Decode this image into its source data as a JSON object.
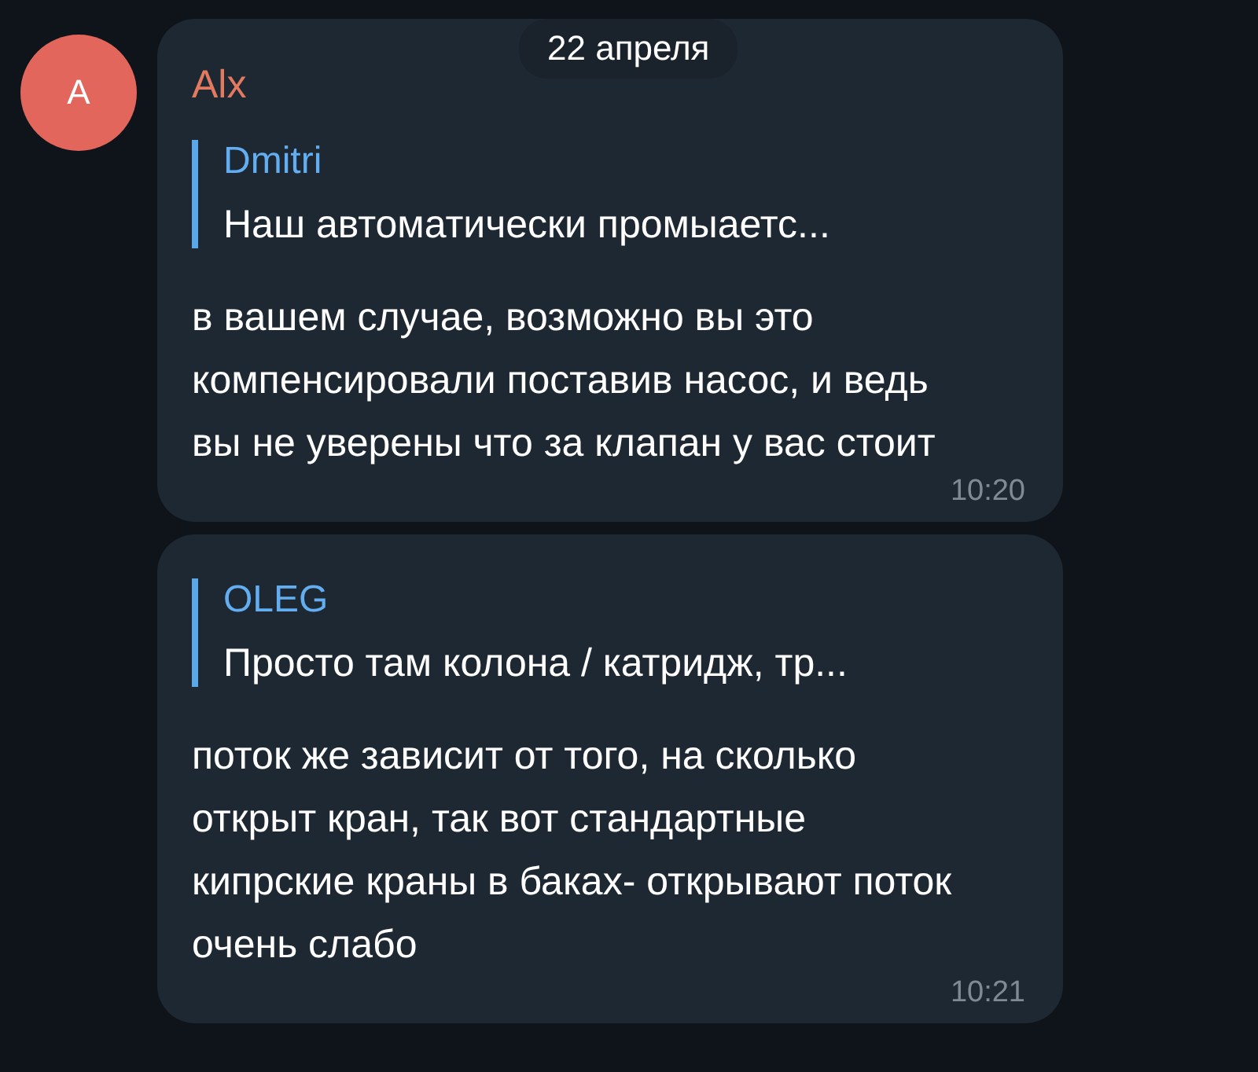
{
  "date_pill": "22 апреля",
  "messages": [
    {
      "avatar": "A",
      "sender": "Alx",
      "reply": {
        "author": "Dmitri",
        "text": "Наш автоматически промыаетс..."
      },
      "text": "в вашем случае, возможно вы это компенсировали поставив насос, и ведь вы не уверены что за клапан у вас стоит",
      "time": "10:20"
    },
    {
      "reply": {
        "author": "OLEG",
        "text": "Просто там колона / катридж, тр..."
      },
      "text": "поток же зависит от того, на сколько открыт кран, так вот стандартные кипрские краны в баках- открывают поток очень слабо",
      "time": "10:21"
    }
  ]
}
